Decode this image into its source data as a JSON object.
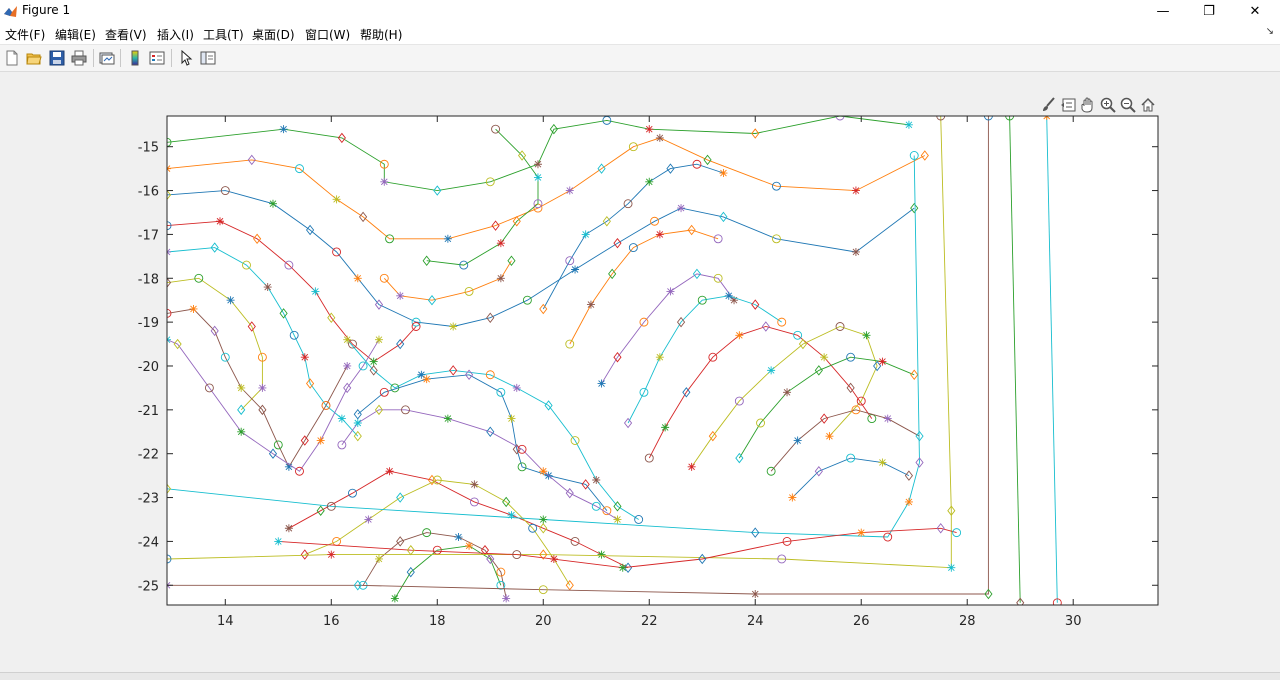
{
  "window": {
    "title": "Figure 1",
    "minimize_glyph": "—",
    "restore_glyph": "❐",
    "close_glyph": "✕"
  },
  "menu": {
    "items": [
      "文件(F)",
      "编辑(E)",
      "查看(V)",
      "插入(I)",
      "工具(T)",
      "桌面(D)",
      "窗口(W)",
      "帮助(H)"
    ],
    "dock_glyph": "↘"
  },
  "toolbar": {
    "buttons": [
      "new-figure-icon",
      "open-file-icon",
      "save-icon",
      "print-icon",
      "link-plot-icon",
      "insert-colorbar-icon",
      "insert-legend-icon",
      "edit-plot-arrow-icon",
      "property-inspector-icon"
    ]
  },
  "axes_toolbar": {
    "buttons": [
      "brush-icon",
      "data-tips-icon",
      "pan-hand-icon",
      "zoom-in-icon",
      "zoom-out-icon",
      "home-restore-icon"
    ]
  },
  "chart_data": {
    "type": "line",
    "title": "",
    "xlabel": "",
    "ylabel": "",
    "xlim": [
      12.9,
      31.6
    ],
    "ylim": [
      -25.45,
      -14.3
    ],
    "xticks": [
      14,
      16,
      18,
      20,
      22,
      24,
      26,
      28,
      30
    ],
    "xtick_labels": [
      "14",
      "16",
      "18",
      "20",
      "22",
      "24",
      "26",
      "28",
      "30"
    ],
    "yticks": [
      -15,
      -16,
      -17,
      -18,
      -19,
      -20,
      -21,
      -22,
      -23,
      -24,
      -25
    ],
    "ytick_labels": [
      "-15",
      "-16",
      "-17",
      "-18",
      "-19",
      "-20",
      "-21",
      "-22",
      "-23",
      "-24",
      "-25"
    ],
    "grid": false,
    "marker_styles": [
      "circle",
      "asterisk",
      "diamond"
    ],
    "marker_colors": [
      "#2ca02c",
      "#1f77b4",
      "#d62728",
      "#ff7f0e",
      "#9467bd",
      "#17becf",
      "#bcbd22",
      "#8c564b"
    ],
    "series": [
      {
        "color": "#2ca02c",
        "x": [
          12.9,
          15.1,
          16.2,
          17.0,
          17.0,
          18.0,
          19.0,
          19.9,
          20.2,
          21.2,
          22.0,
          24.0,
          25.6,
          26.9
        ],
        "y": [
          -14.9,
          -14.6,
          -14.8,
          -15.4,
          -15.8,
          -16.0,
          -15.8,
          -15.4,
          -14.6,
          -14.4,
          -14.6,
          -14.7,
          -14.3,
          -14.5
        ]
      },
      {
        "color": "#ff7f0e",
        "x": [
          12.9,
          14.5,
          15.4,
          16.1,
          16.6,
          17.1,
          18.2,
          19.1,
          19.9,
          20.5,
          21.1,
          21.7,
          22.2,
          23.1,
          24.4,
          25.9,
          27.2
        ],
        "y": [
          -15.5,
          -15.3,
          -15.5,
          -16.2,
          -16.6,
          -17.1,
          -17.1,
          -16.8,
          -16.4,
          -16.0,
          -15.5,
          -15.0,
          -14.8,
          -15.3,
          -15.9,
          -16.0,
          -15.2
        ]
      },
      {
        "color": "#1f77b4",
        "x": [
          12.9,
          14.0,
          14.9,
          15.6,
          16.1,
          16.5,
          16.9,
          17.6,
          18.3,
          19.0,
          19.7,
          20.6,
          21.4,
          22.1,
          22.6,
          23.4,
          24.4,
          25.9,
          27.0
        ],
        "y": [
          -16.1,
          -16.0,
          -16.3,
          -16.9,
          -17.4,
          -18.0,
          -18.6,
          -19.0,
          -19.1,
          -18.9,
          -18.5,
          -17.8,
          -17.2,
          -16.7,
          -16.4,
          -16.6,
          -17.1,
          -17.4,
          -16.4
        ]
      },
      {
        "color": "#d62728",
        "x": [
          12.9,
          13.9,
          14.6,
          15.2,
          15.7,
          16.0,
          16.4,
          16.8,
          17.3,
          17.6
        ],
        "y": [
          -16.8,
          -16.7,
          -17.1,
          -17.7,
          -18.3,
          -18.9,
          -19.5,
          -19.9,
          -19.5,
          -19.1
        ]
      },
      {
        "color": "#17becf",
        "x": [
          12.9,
          13.8,
          14.4,
          14.8,
          15.1,
          15.3,
          15.5,
          15.6,
          15.9,
          16.2,
          16.5
        ],
        "y": [
          -17.4,
          -17.3,
          -17.7,
          -18.2,
          -18.8,
          -19.3,
          -19.8,
          -20.4,
          -20.9,
          -21.2,
          -21.6
        ]
      },
      {
        "color": "#bcbd22",
        "x": [
          12.9,
          13.5,
          14.1,
          14.5,
          14.7,
          14.7,
          14.3
        ],
        "y": [
          -18.1,
          -18.0,
          -18.5,
          -19.1,
          -19.8,
          -20.5,
          -21.0
        ]
      },
      {
        "color": "#8c564b",
        "x": [
          12.9,
          13.4,
          13.8,
          14.0,
          14.3,
          14.7,
          15.0,
          15.2,
          15.5,
          15.9,
          16.3
        ],
        "y": [
          -18.8,
          -18.7,
          -19.2,
          -19.8,
          -20.5,
          -21.0,
          -21.8,
          -22.3,
          -21.7,
          -20.9,
          -20.0
        ]
      },
      {
        "color": "#9467bd",
        "x": [
          12.9,
          13.1,
          13.7,
          14.3,
          14.9,
          15.4,
          15.8,
          16.3,
          16.6,
          16.9
        ],
        "y": [
          -19.4,
          -19.5,
          -20.5,
          -21.5,
          -22.0,
          -22.4,
          -21.7,
          -20.5,
          -20.0,
          -19.4
        ]
      },
      {
        "color": "#2ca02c",
        "x": [
          17.8,
          18.5,
          19.2,
          19.5,
          19.9,
          19.9,
          19.6,
          19.1
        ],
        "y": [
          -17.6,
          -17.7,
          -17.2,
          -16.7,
          -16.3,
          -15.7,
          -15.2,
          -14.6
        ]
      },
      {
        "color": "#ff7f0e",
        "x": [
          17.0,
          17.3,
          17.9,
          18.6,
          19.2,
          19.4
        ],
        "y": [
          -18.0,
          -18.4,
          -18.5,
          -18.3,
          -18.0,
          -17.6
        ]
      },
      {
        "color": "#17becf",
        "x": [
          16.3,
          16.8,
          17.2,
          17.7,
          18.3,
          19.0,
          19.5,
          20.1,
          20.6,
          21.0,
          21.4,
          21.8
        ],
        "y": [
          -19.4,
          -20.1,
          -20.5,
          -20.2,
          -20.1,
          -20.2,
          -20.5,
          -20.9,
          -21.7,
          -22.6,
          -23.2,
          -23.5
        ]
      },
      {
        "color": "#1f77b4",
        "x": [
          16.5,
          17.0,
          17.8,
          18.6,
          19.2,
          19.4,
          19.5,
          19.6,
          20.1,
          20.8,
          21.2
        ],
        "y": [
          -21.1,
          -20.6,
          -20.3,
          -20.2,
          -20.6,
          -21.2,
          -21.9,
          -22.3,
          -22.5,
          -22.7,
          -23.3
        ]
      },
      {
        "color": "#9467bd",
        "x": [
          16.2,
          16.5,
          16.9,
          17.4,
          18.2,
          19.0,
          19.6,
          20.0,
          20.5,
          21.0,
          21.4
        ],
        "y": [
          -21.8,
          -21.3,
          -21.0,
          -21.0,
          -21.2,
          -21.5,
          -21.9,
          -22.4,
          -22.9,
          -23.2,
          -23.5
        ]
      },
      {
        "color": "#d62728",
        "x": [
          15.2,
          15.8,
          16.4,
          17.1,
          17.9,
          18.7,
          19.4,
          20.0,
          20.6,
          21.1,
          21.6
        ],
        "y": [
          -23.7,
          -23.3,
          -22.9,
          -22.4,
          -22.6,
          -23.1,
          -23.4,
          -23.7,
          -24.0,
          -24.3,
          -24.6
        ]
      },
      {
        "color": "#bcbd22",
        "x": [
          15.5,
          16.1,
          16.7,
          17.3,
          18.0,
          18.7,
          19.3,
          19.8,
          20.2,
          20.5
        ],
        "y": [
          -24.3,
          -24.0,
          -23.5,
          -23.0,
          -22.6,
          -22.7,
          -23.1,
          -23.7,
          -24.4,
          -25.0
        ]
      },
      {
        "color": "#8c564b",
        "x": [
          16.6,
          16.9,
          17.3,
          17.8,
          18.4,
          18.9,
          19.2,
          19.3
        ],
        "y": [
          -25.0,
          -24.4,
          -24.0,
          -23.8,
          -23.9,
          -24.2,
          -24.7,
          -25.3
        ]
      },
      {
        "color": "#2ca02c",
        "x": [
          17.2,
          17.5,
          18.0,
          18.6,
          19.0,
          19.2
        ],
        "y": [
          -25.3,
          -24.7,
          -24.2,
          -24.1,
          -24.4,
          -25.0
        ]
      },
      {
        "color": "#1f77b4",
        "x": [
          20.0,
          20.5,
          20.8,
          21.2,
          21.6,
          22.0,
          22.4,
          22.9,
          23.4
        ],
        "y": [
          -18.7,
          -17.6,
          -17.0,
          -16.7,
          -16.3,
          -15.8,
          -15.5,
          -15.4,
          -15.6
        ]
      },
      {
        "color": "#ff7f0e",
        "x": [
          20.5,
          20.9,
          21.3,
          21.7,
          22.2,
          22.8,
          23.3
        ],
        "y": [
          -19.5,
          -18.6,
          -17.9,
          -17.3,
          -17.0,
          -16.9,
          -17.1
        ]
      },
      {
        "color": "#9467bd",
        "x": [
          21.1,
          21.4,
          21.9,
          22.4,
          22.9,
          23.3,
          23.6
        ],
        "y": [
          -20.4,
          -19.8,
          -19.0,
          -18.3,
          -17.9,
          -18.0,
          -18.5
        ]
      },
      {
        "color": "#17becf",
        "x": [
          21.6,
          21.9,
          22.2,
          22.6,
          23.0,
          23.5,
          24.0,
          24.5
        ],
        "y": [
          -21.3,
          -20.6,
          -19.8,
          -19.0,
          -18.5,
          -18.4,
          -18.6,
          -19.0
        ]
      },
      {
        "color": "#d62728",
        "x": [
          22.0,
          22.3,
          22.7,
          23.2,
          23.7,
          24.2,
          24.8,
          25.3,
          25.8,
          26.2
        ],
        "y": [
          -22.1,
          -21.4,
          -20.6,
          -19.8,
          -19.3,
          -19.1,
          -19.3,
          -19.8,
          -20.5,
          -21.2
        ]
      },
      {
        "color": "#bcbd22",
        "x": [
          22.8,
          23.2,
          23.7,
          24.3,
          24.9,
          25.6,
          26.1,
          26.3,
          26.0,
          25.4
        ],
        "y": [
          -22.3,
          -21.6,
          -20.8,
          -20.1,
          -19.5,
          -19.1,
          -19.3,
          -20.0,
          -20.8,
          -21.6
        ]
      },
      {
        "color": "#2ca02c",
        "x": [
          23.7,
          24.1,
          24.6,
          25.2,
          25.8,
          26.4,
          27.0
        ],
        "y": [
          -22.1,
          -21.3,
          -20.6,
          -20.1,
          -19.8,
          -19.9,
          -20.2
        ]
      },
      {
        "color": "#8c564b",
        "x": [
          24.3,
          24.8,
          25.3,
          25.9,
          26.5,
          27.1
        ],
        "y": [
          -22.4,
          -21.7,
          -21.2,
          -21.0,
          -21.2,
          -21.6
        ]
      },
      {
        "color": "#1f77b4",
        "x": [
          24.7,
          25.2,
          25.8,
          26.4,
          26.9
        ],
        "y": [
          -23.0,
          -22.4,
          -22.1,
          -22.2,
          -22.5
        ]
      },
      {
        "color": "#17becf",
        "x": [
          12.9,
          16.0,
          20.0,
          24.0,
          26.5,
          26.9,
          27.1,
          27.0
        ],
        "y": [
          -22.8,
          -23.2,
          -23.5,
          -23.8,
          -23.9,
          -23.1,
          -22.2,
          -15.2
        ]
      },
      {
        "color": "#bcbd22",
        "x": [
          12.9,
          16.0,
          20.0,
          24.5,
          27.7,
          27.7,
          27.5
        ],
        "y": [
          -24.4,
          -24.3,
          -24.3,
          -24.4,
          -24.6,
          -23.3,
          -14.3
        ]
      },
      {
        "color": "#8c564b",
        "x": [
          12.9,
          16.5,
          20.0,
          24.0,
          28.4,
          28.4
        ],
        "y": [
          -25.0,
          -25.0,
          -25.1,
          -25.2,
          -25.2,
          -14.3
        ]
      },
      {
        "color": "#2ca02c",
        "x": [
          29.0,
          28.8
        ],
        "y": [
          -25.4,
          -14.3
        ]
      },
      {
        "color": "#17becf",
        "x": [
          29.7,
          29.5
        ],
        "y": [
          -25.4,
          -14.3
        ]
      },
      {
        "color": "#d62728",
        "x": [
          15.0,
          17.5,
          19.5,
          21.5,
          23.0,
          24.6,
          26.0,
          27.5,
          27.8
        ],
        "y": [
          -24.0,
          -24.2,
          -24.3,
          -24.6,
          -24.4,
          -24.0,
          -23.8,
          -23.7,
          -23.8
        ]
      }
    ]
  },
  "status": {
    "text": ""
  }
}
